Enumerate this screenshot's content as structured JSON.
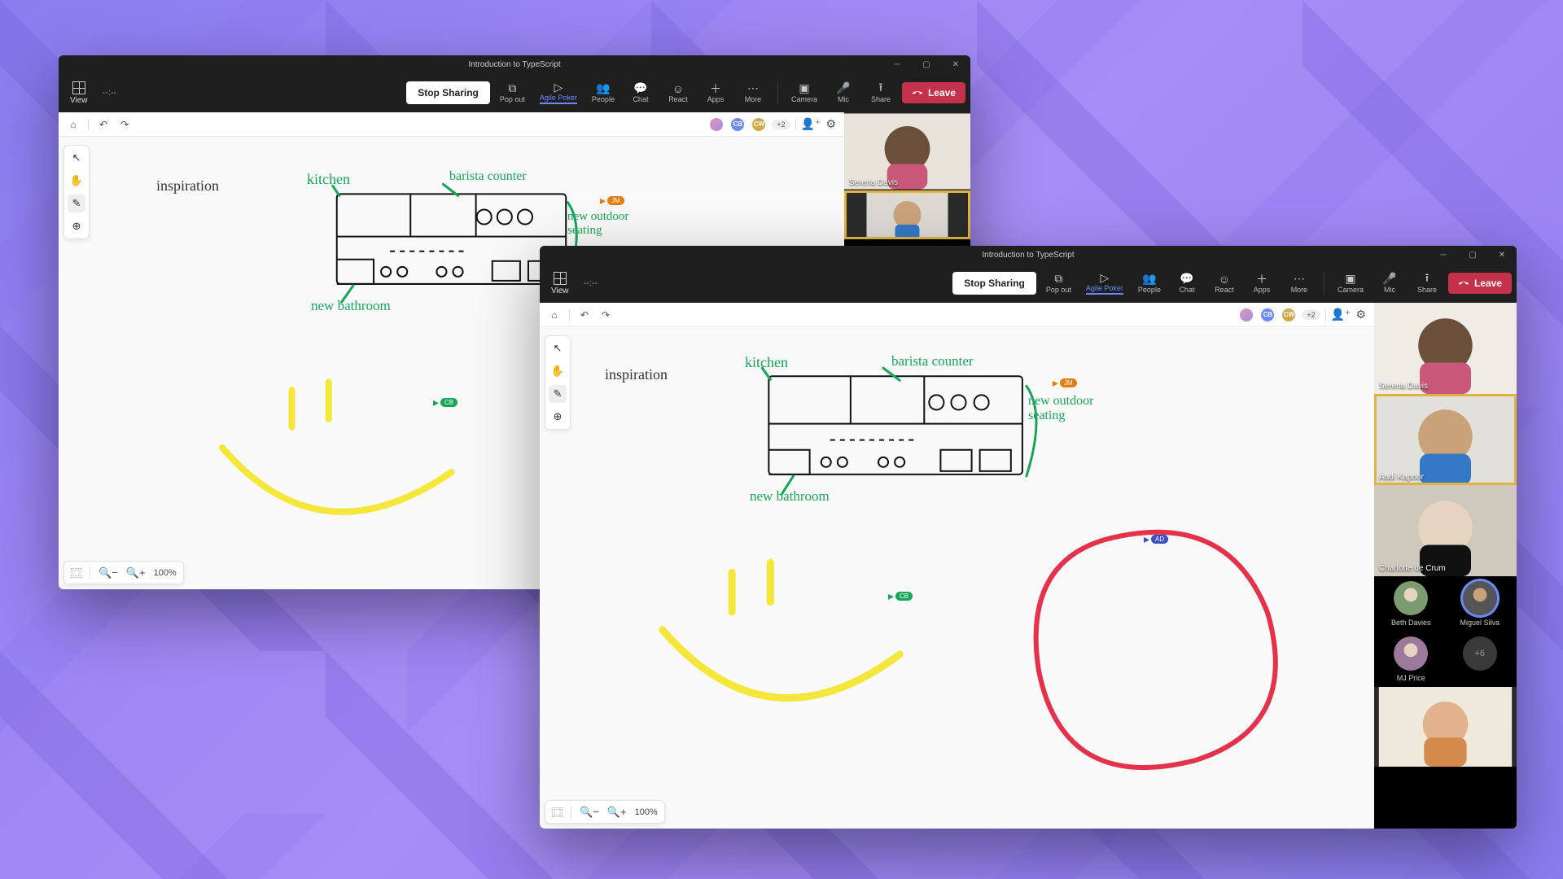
{
  "windows": [
    {
      "title": "Introduction to TypeScript",
      "time": "--:--"
    },
    {
      "title": "Introduction to TypeScript",
      "time": "--:--"
    }
  ],
  "toolbar": {
    "view": "View",
    "stop_sharing": "Stop Sharing",
    "buttons": [
      {
        "name": "popout",
        "label": "Pop out"
      },
      {
        "name": "agile",
        "label": "Agile Poker"
      },
      {
        "name": "people",
        "label": "People"
      },
      {
        "name": "chat",
        "label": "Chat"
      },
      {
        "name": "react",
        "label": "React"
      },
      {
        "name": "apps",
        "label": "Apps"
      },
      {
        "name": "more",
        "label": "More"
      }
    ],
    "right": [
      {
        "name": "camera",
        "label": "Camera"
      },
      {
        "name": "mic",
        "label": "Mic"
      },
      {
        "name": "share",
        "label": "Share"
      }
    ],
    "leave": "Leave"
  },
  "canvas": {
    "collab_more": "+2",
    "zoom": "100%",
    "annotations": {
      "inspiration": "inspiration",
      "kitchen": "kitchen",
      "barista": "barista counter",
      "outdoor": "new outdoor seating",
      "bathroom": "new bathroom"
    },
    "cursor1": "CB",
    "cursor2": "JM",
    "cursor3": "AD"
  },
  "participants": {
    "win1": [
      {
        "name": "Serena Davis"
      }
    ],
    "win2_tiles": [
      {
        "name": "Serena Davis",
        "speaking": false
      },
      {
        "name": "Aadi Kapoor",
        "speaking": true
      },
      {
        "name": "Charlotte de Crum",
        "speaking": false
      }
    ],
    "win2_row1": [
      {
        "name": "Beth Davies"
      },
      {
        "name": "Miguel Silva",
        "ring": true
      }
    ],
    "win2_row2": [
      {
        "name": "MJ Price"
      },
      {
        "name": "+6",
        "more": true
      }
    ]
  }
}
